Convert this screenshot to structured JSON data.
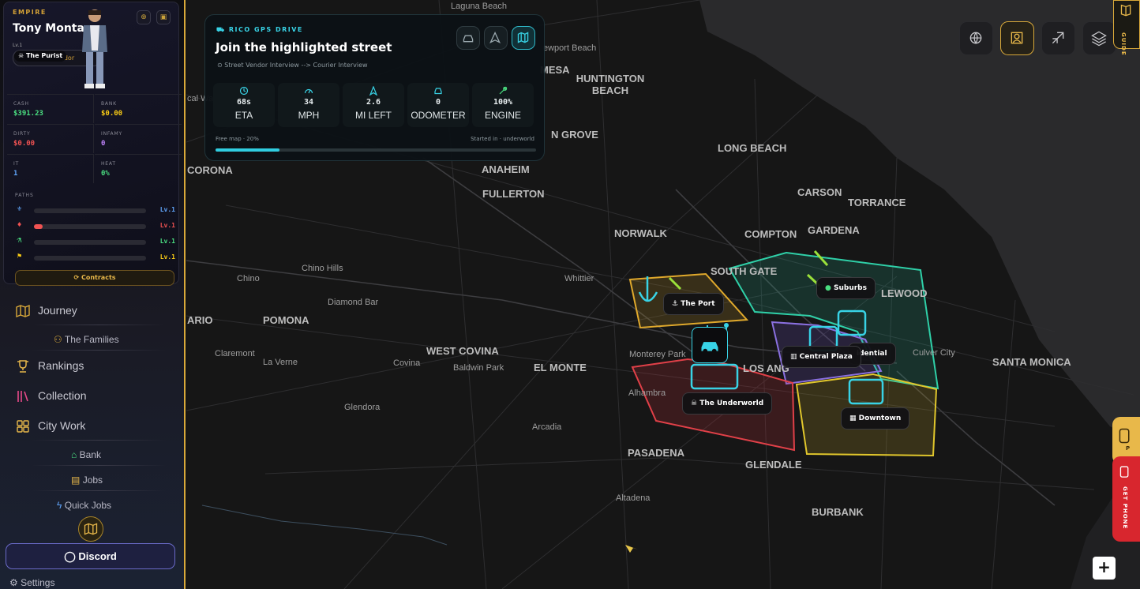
{
  "profile": {
    "empire_label": "EMPIRE",
    "name": "Tony Montana",
    "level": "Lv.1",
    "title": "The Purist",
    "subtitle": "Vendor",
    "icons": [
      "pin-icon",
      "lock-icon"
    ]
  },
  "stats": {
    "cash": {
      "label": "CASH",
      "value": "$391.23",
      "color": "#4ade80"
    },
    "bank": {
      "label": "BANK",
      "value": "$0.00",
      "color": "#facc15"
    },
    "dirty": {
      "label": "DIRTY",
      "value": "$0.00",
      "color": "#f05252"
    },
    "infamy": {
      "label": "INFAMY",
      "value": "0",
      "color": "#c084fc"
    },
    "it": {
      "label": "IT",
      "value": "1",
      "color": "#60a5fa"
    },
    "heat": {
      "label": "HEAT",
      "value": "0%",
      "color": "#4ade80"
    }
  },
  "paths": {
    "label": "PATHS",
    "items": [
      {
        "level": "Lv.1",
        "color": "#60a5fa",
        "progress": 0
      },
      {
        "level": "Lv.1",
        "color": "#f05252",
        "progress": 0.08
      },
      {
        "level": "Lv.1",
        "color": "#4ade80",
        "progress": 0
      },
      {
        "level": "Lv.1",
        "color": "#facc15",
        "progress": 0
      }
    ]
  },
  "contracts_label": "Contracts",
  "nav": {
    "journey": "Journey",
    "families": "The Families",
    "rankings": "Rankings",
    "collection": "Collection",
    "city_work": "City Work",
    "bank": "Bank",
    "jobs": "Jobs",
    "quick_jobs": "Quick Jobs",
    "discord": "Discord",
    "settings": "Settings"
  },
  "gps": {
    "header": "RICO GPS DRIVE",
    "title": "Join the highlighted street",
    "route": "Street Vendor Interview --> Courier Interview",
    "cells": [
      {
        "value": "68s",
        "label": "ETA"
      },
      {
        "value": "34",
        "label": "MPH"
      },
      {
        "value": "2.6",
        "label": "MI LEFT"
      },
      {
        "value": "0",
        "label": "ODOMETER"
      },
      {
        "value": "100%",
        "label": "ENGINE"
      }
    ],
    "progress_label": "Free map · 20%",
    "progress": 0.2,
    "started": "Started in · underworld"
  },
  "map_places": {
    "big": [
      "HUNTINGTON BEACH",
      "MESA",
      "LONG BEACH",
      "ANAHEIM",
      "FULLERTON",
      "CARSON",
      "TORRANCE",
      "NORWALK",
      "COMPTON",
      "GARDENA",
      "SOUTH GATE",
      "LEWOOD",
      "POMONA",
      "WEST COVINA",
      "EL MONTE",
      "LOS ANG",
      "SANTA MONICA",
      "PASADENA",
      "GLENDALE",
      "BURBANK",
      "CORONA",
      "ARIO",
      "N GROVE"
    ],
    "small": [
      "Laguna Beach",
      "ewport Beach",
      "cal Wa",
      "Chino",
      "Chino Hills",
      "Whittier",
      "Diamond Bar",
      "Claremont",
      "La Verne",
      "Covina",
      "Baldwin Park",
      "Monterey Park",
      "Alhambra",
      "Culver City",
      "Glendora",
      "Arcadia",
      "Altadena"
    ]
  },
  "zones": {
    "port": "The Port",
    "suburbs": "Suburbs",
    "residential": "idential",
    "central_plaza": "Central Plaza",
    "underworld": "The Underworld",
    "downtown": "Downtown"
  },
  "right_ui": {
    "guide": "GUIDE",
    "get_phone": "GET PHONE",
    "phone_tab_text": "P",
    "zoom_in": "+"
  }
}
